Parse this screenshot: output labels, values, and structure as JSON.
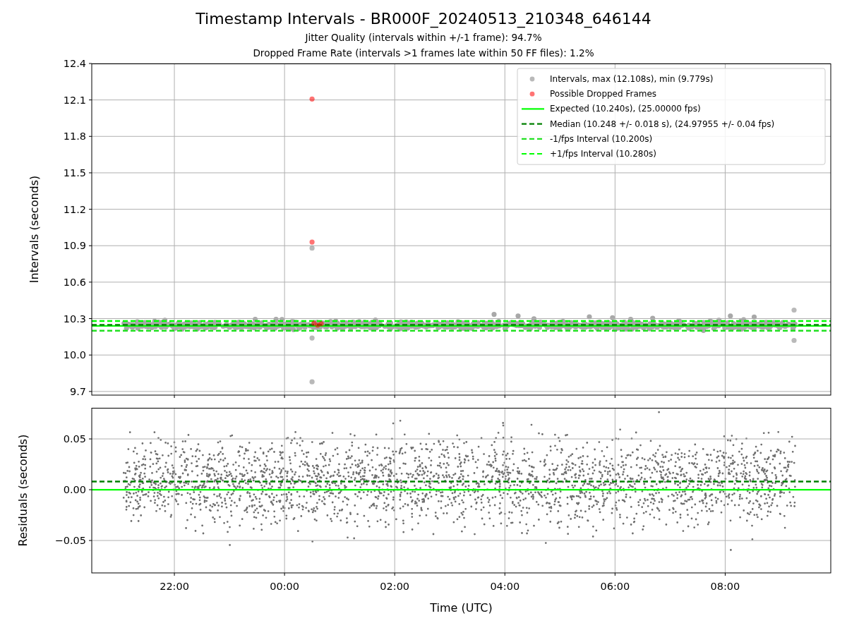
{
  "figure": {
    "title": "Timestamp Intervals - BR000F_20240513_210348_646144",
    "subtitles": [
      "Jitter Quality (intervals within +/-1 frame): 94.7%",
      "Dropped Frame Rate (intervals >1 frames late within 50 FF files): 1.2%"
    ]
  },
  "intervals_plot": {
    "chart_data": {
      "type": "scatter",
      "ylabel": "Intervals (seconds)",
      "xlim": [
        "2024-05-13T20:30",
        "2024-05-14T09:55"
      ],
      "ylim": [
        9.67,
        12.4
      ],
      "yticks": [
        {
          "value": 9.7,
          "label": "9.7"
        },
        {
          "value": 10.0,
          "label": "10.0"
        },
        {
          "value": 10.3,
          "label": "10.3"
        },
        {
          "value": 10.6,
          "label": "10.6"
        },
        {
          "value": 10.9,
          "label": "10.9"
        },
        {
          "value": 11.2,
          "label": "11.2"
        },
        {
          "value": 11.5,
          "label": "11.5"
        },
        {
          "value": 11.8,
          "label": "11.8"
        },
        {
          "value": 12.1,
          "label": "12.1"
        },
        {
          "value": 12.4,
          "label": "12.4"
        }
      ],
      "series": [
        {
          "name": "Intervals, max (12.108s), min (9.779s)",
          "color": "#808080",
          "x": [
            "2024-05-14T00:30",
            "2024-05-14T00:30",
            "2024-05-14T00:30",
            "2024-05-14T09:15",
            "2024-05-14T09:15"
          ],
          "values": [
            10.88,
            9.779,
            10.14,
            10.37,
            10.12
          ]
        },
        {
          "name": "Possible Dropped Frames",
          "color": "#ff0000",
          "x": [
            "2024-05-14T00:30",
            "2024-05-14T00:30",
            "2024-05-14T00:32",
            "2024-05-14T00:36",
            "2024-05-14T00:40"
          ],
          "values": [
            12.108,
            10.93,
            10.262,
            10.246,
            10.258
          ]
        },
        {
          "name": "Expected (10.240s), (25.00000 fps)",
          "type": "line",
          "line_style": "solid",
          "color": "#00ff00",
          "x": [
            "2024-05-13T20:30",
            "2024-05-14T09:55"
          ],
          "values": [
            10.24,
            10.24
          ]
        },
        {
          "name": "Median (10.248 +/- 0.018 s), (24.97955 +/- 0.04 fps)",
          "type": "line",
          "line_style": "dashed",
          "color": "#008000",
          "x": [
            "2024-05-13T20:30",
            "2024-05-14T09:55"
          ],
          "values": [
            10.248,
            10.248
          ]
        },
        {
          "name": "-1/fps Interval (10.200s)",
          "type": "line",
          "line_style": "dashed",
          "color": "#22e022",
          "x": [
            "2024-05-13T20:30",
            "2024-05-14T09:55"
          ],
          "values": [
            10.2,
            10.2
          ]
        },
        {
          "name": "+1/fps Interval (10.280s)",
          "type": "line",
          "line_style": "dashed",
          "color": "#00ff00",
          "x": [
            "2024-05-13T20:30",
            "2024-05-14T09:55"
          ],
          "values": [
            10.28,
            10.28
          ]
        }
      ],
      "grid": true,
      "legend": "upper right"
    }
  },
  "residuals_plot": {
    "chart_data": {
      "type": "scatter",
      "xlabel": "Time (UTC)",
      "ylabel": "Residuals (seconds)",
      "xlim": [
        "2024-05-13T20:30",
        "2024-05-14T09:55"
      ],
      "ylim": [
        -0.0819,
        0.0806
      ],
      "xticks": [
        {
          "value": "2024-05-13T22:00",
          "label": "22:00"
        },
        {
          "value": "2024-05-14T00:00",
          "label": "00:00"
        },
        {
          "value": "2024-05-14T02:00",
          "label": "02:00"
        },
        {
          "value": "2024-05-14T04:00",
          "label": "04:00"
        },
        {
          "value": "2024-05-14T06:00",
          "label": "06:00"
        },
        {
          "value": "2024-05-14T08:00",
          "label": "08:00"
        }
      ],
      "yticks": [
        {
          "value": -0.05,
          "label": "−0.05"
        },
        {
          "value": 0,
          "label": "0.00"
        },
        {
          "value": 0.05,
          "label": "0.05"
        }
      ],
      "grid": true,
      "series": [
        {
          "type": "line",
          "line_style": "solid",
          "color": "#00ff00",
          "x": [
            "2024-05-13T20:30",
            "2024-05-14T09:55"
          ],
          "values": [
            0,
            0
          ]
        },
        {
          "type": "line",
          "line_style": "dashed",
          "color": "#008000",
          "x": [
            "2024-05-13T20:30",
            "2024-05-14T09:55"
          ],
          "values": [
            0.008,
            0.008
          ]
        }
      ]
    }
  }
}
